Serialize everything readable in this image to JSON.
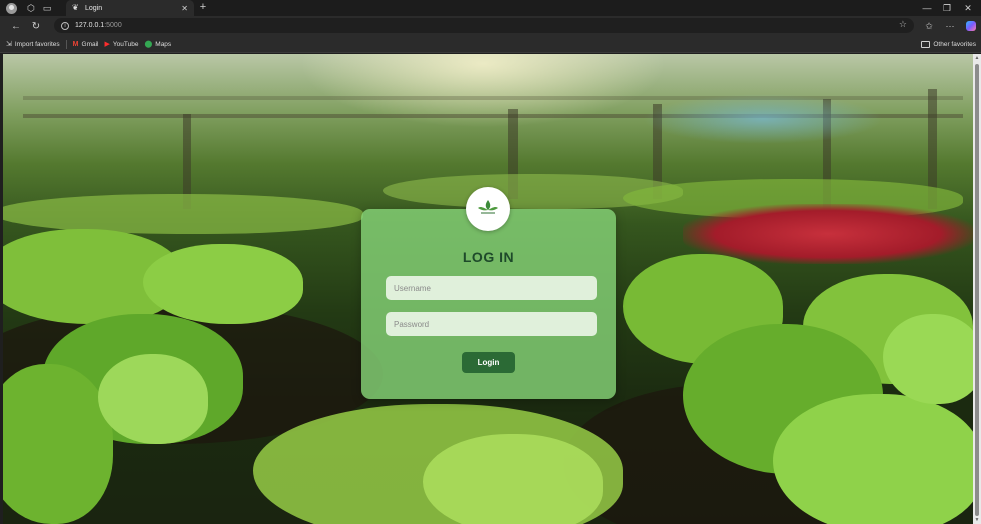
{
  "browser": {
    "tab": {
      "title": "Login",
      "favicon": "leaf-favicon-icon"
    },
    "address": {
      "host": "127.0.0.1",
      "port": ":5000"
    },
    "bookmarks": [
      {
        "label": "Import favorites",
        "icon": "import-icon"
      },
      {
        "label": "Gmail",
        "icon": "gmail-icon"
      },
      {
        "label": "YouTube",
        "icon": "youtube-icon"
      },
      {
        "label": "Maps",
        "icon": "maps-icon"
      }
    ],
    "other_favorites": "Other favorites"
  },
  "login": {
    "title": "LOG IN",
    "username_placeholder": "Username",
    "password_placeholder": "Password",
    "button_label": "Login",
    "logo_text": "FARMFIELD"
  },
  "colors": {
    "card": "#85d276",
    "button": "#2b6a35",
    "title": "#1e4a2a"
  }
}
